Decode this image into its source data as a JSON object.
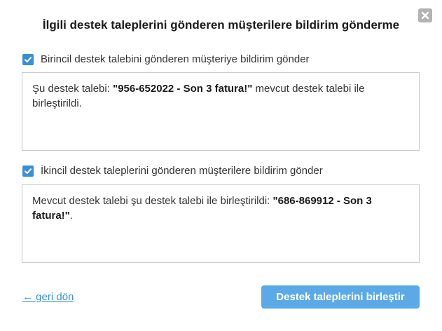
{
  "dialog": {
    "title": "İlgili destek taleplerini gönderen müşterilere bildirim gönderme",
    "close_icon": "close-icon"
  },
  "primary": {
    "checked": true,
    "label": "Birincil destek talebini gönderen müşteriye bildirim gönder",
    "message_prefix": "Şu destek talebi: ",
    "message_ticket": "\"956-652022 - Son 3 fatura!\"",
    "message_suffix": " mevcut destek talebi ile birleştirildi."
  },
  "secondary": {
    "checked": true,
    "label": "İkincil destek taleplerini gönderen müşterilere bildirim gönder",
    "message_prefix": "Mevcut destek talebi şu destek talebi ile birleştirildi: ",
    "message_ticket": "\"686-869912 - Son 3 fatura!\"",
    "message_suffix": "."
  },
  "footer": {
    "back_label": "← geri dön",
    "merge_label": "Destek taleplerini birleştir"
  },
  "colors": {
    "accent": "#3a8fd6",
    "button": "#5ba9e6",
    "close": "#b3b3b3"
  }
}
